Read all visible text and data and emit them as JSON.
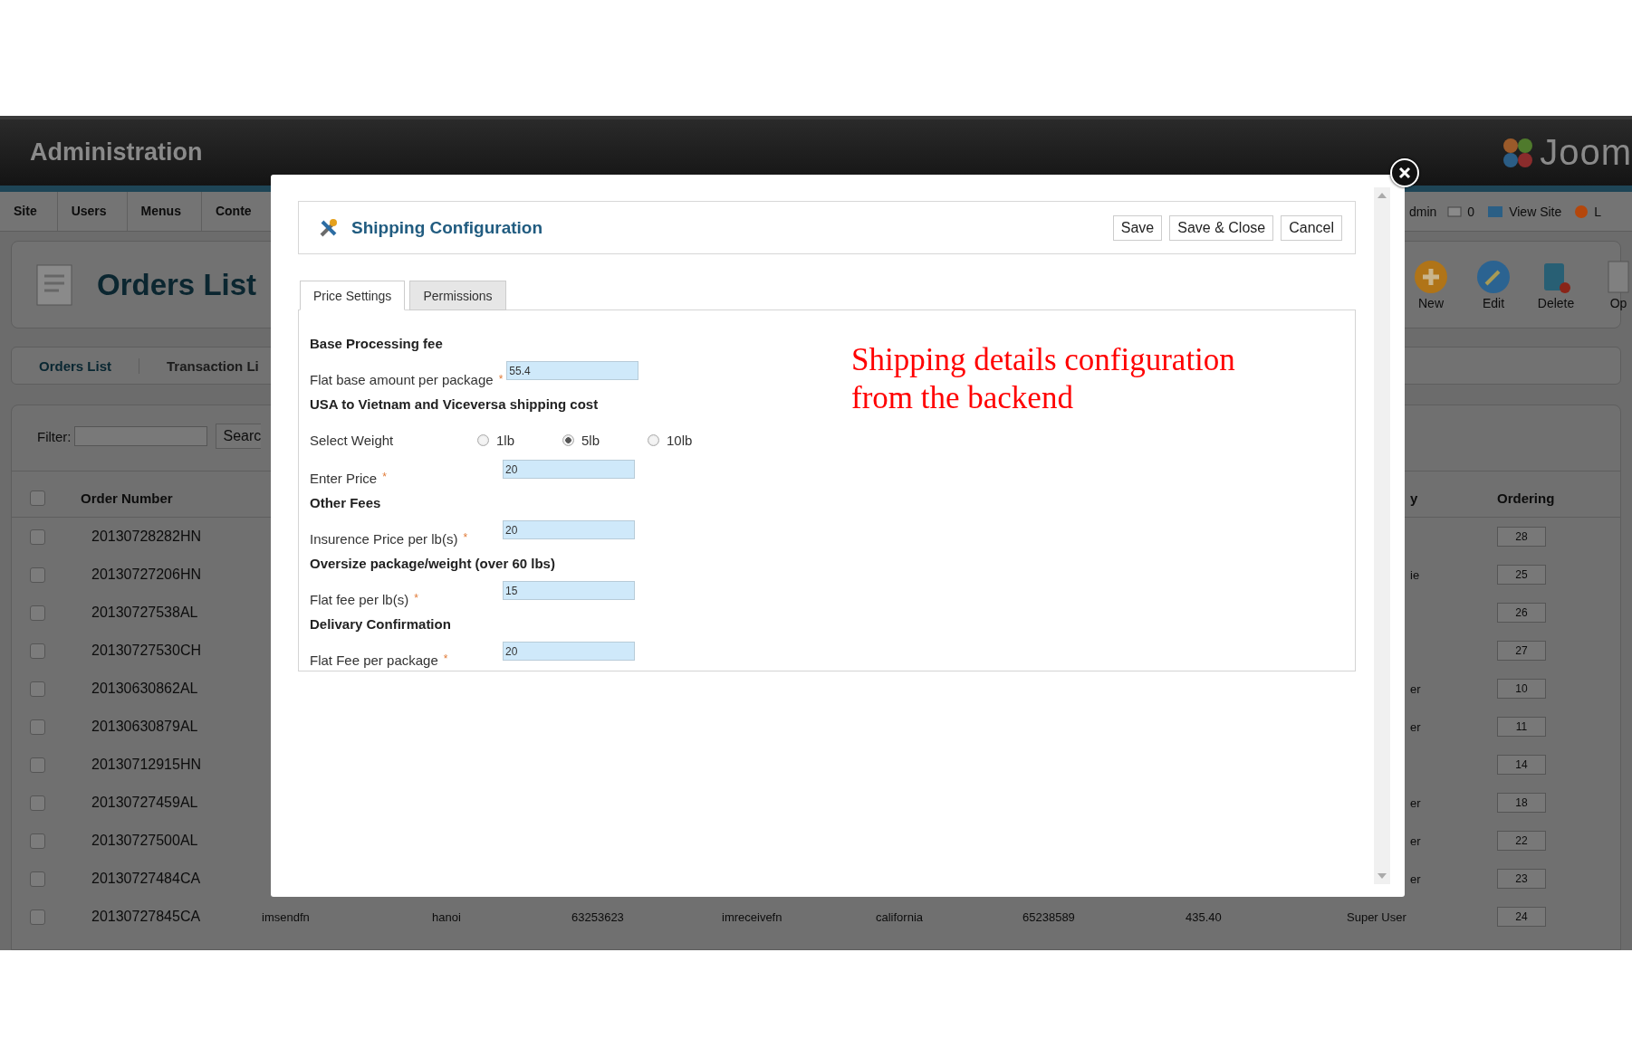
{
  "header": {
    "title": "Administration",
    "logo": "Joom"
  },
  "menu": {
    "items": [
      "Site",
      "Users",
      "Menus",
      "Conte"
    ],
    "user": "dmin",
    "messages": "0",
    "view_site": "View Site",
    "logout": "L"
  },
  "page": {
    "title": "Orders List",
    "toolbar": [
      {
        "kind": "new",
        "label": "New"
      },
      {
        "kind": "edit",
        "label": "Edit"
      },
      {
        "kind": "delete",
        "label": "Delete"
      },
      {
        "kind": "options",
        "label": "Op"
      }
    ]
  },
  "submenu": [
    {
      "label": "Orders List",
      "selected": true
    },
    {
      "label": "Transaction Li",
      "selected": false
    }
  ],
  "filter": {
    "label": "Filter:",
    "button": "Searc"
  },
  "table": {
    "select_all": {
      "checked": false
    },
    "columns": {
      "order_number": "Order Number",
      "created_by": "y",
      "ordering": "Ordering"
    },
    "rows": [
      {
        "checked": false,
        "order_number": "20130728282HN",
        "ordering": "28"
      },
      {
        "checked": false,
        "order_number": "20130727206HN",
        "created_by": "ie",
        "ordering": "25"
      },
      {
        "checked": false,
        "order_number": "20130727538AL",
        "ordering": "26"
      },
      {
        "checked": false,
        "order_number": "20130727530CH",
        "ordering": "27"
      },
      {
        "checked": false,
        "order_number": "20130630862AL",
        "created_by": "er",
        "ordering": "10"
      },
      {
        "checked": false,
        "order_number": "20130630879AL",
        "created_by": "er",
        "ordering": "11"
      },
      {
        "checked": false,
        "order_number": "20130712915HN",
        "ordering": "14"
      },
      {
        "checked": false,
        "order_number": "20130727459AL",
        "created_by": "er",
        "ordering": "18"
      },
      {
        "checked": false,
        "order_number": "20130727500AL",
        "created_by": "er",
        "ordering": "22"
      },
      {
        "checked": false,
        "order_number": "20130727484CA",
        "created_by": "er",
        "ordering": "23"
      },
      {
        "checked": false,
        "order_number": "20130727845CA",
        "cells": [
          "imsendfn",
          "hanoi",
          "63253623",
          "imreceivefn",
          "california",
          "65238589",
          "435.40"
        ],
        "created_by": "Super User",
        "ordering": "24"
      }
    ]
  },
  "modal": {
    "title": "Shipping Configuration",
    "buttons": [
      "Save",
      "Save & Close",
      "Cancel"
    ],
    "tabs": [
      {
        "label": "Price Settings",
        "selected": true
      },
      {
        "label": "Permissions",
        "selected": false
      }
    ],
    "sections": [
      {
        "heading": "Base Processing fee",
        "fields": [
          {
            "kind": "inline-input",
            "label": "Flat base amount per package",
            "marker": "*",
            "value": "55.4"
          }
        ]
      },
      {
        "heading": "USA to Vietnam and Viceversa shipping cost",
        "fields": [
          {
            "kind": "radio",
            "label": "Select Weight",
            "options": [
              {
                "label": "1lb",
                "selected": false
              },
              {
                "label": "5lb",
                "selected": true
              },
              {
                "label": "10lb",
                "selected": false
              }
            ]
          },
          {
            "kind": "input",
            "label": "Enter Price",
            "marker": "*",
            "value": "20"
          }
        ]
      },
      {
        "heading": "Other Fees",
        "fields": [
          {
            "kind": "input",
            "label": "Insurence Price per lb(s)",
            "marker": "*",
            "value": "20"
          }
        ]
      },
      {
        "heading": "Oversize package/weight (over 60 lbs)",
        "fields": [
          {
            "kind": "input",
            "label": "Flat fee per lb(s)",
            "marker": "*",
            "value": "15"
          }
        ]
      },
      {
        "heading": "Delivary Confirmation",
        "fields": [
          {
            "kind": "input",
            "label": "Flat Fee per package",
            "marker": "*",
            "value": "20"
          }
        ]
      }
    ],
    "annotation": "Shipping details configuration from the backend"
  }
}
